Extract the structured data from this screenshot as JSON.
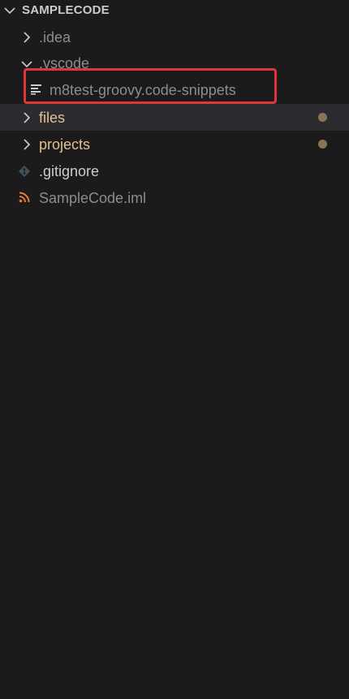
{
  "explorer": {
    "section_title": "SAMPLECODE",
    "items": [
      {
        "label": ".idea",
        "kind": "folder",
        "state": "collapsed",
        "icon": "chevron-right-icon"
      },
      {
        "label": ".vscode",
        "kind": "folder",
        "state": "expanded",
        "icon": "chevron-down-icon"
      },
      {
        "label": "m8test-groovy.code-snippets",
        "kind": "file",
        "icon": "snippets-file-icon"
      },
      {
        "label": "files",
        "kind": "folder",
        "state": "collapsed",
        "modified": true,
        "selected": true,
        "icon": "chevron-right-icon"
      },
      {
        "label": "projects",
        "kind": "folder",
        "state": "collapsed",
        "modified": true,
        "icon": "chevron-right-icon"
      },
      {
        "label": ".gitignore",
        "kind": "file",
        "icon": "git-file-icon"
      },
      {
        "label": "SampleCode.iml",
        "kind": "file",
        "icon": "rss-file-icon"
      }
    ]
  },
  "colors": {
    "background": "#1b1b1c",
    "selected_row": "#2b2b30",
    "modified_folder": "#e2c08d",
    "modified_dot": "#8a7456",
    "muted_text": "#8c8c8c",
    "highlight_border": "#e0353a",
    "gitignore_icon": "#41535b",
    "iml_icon": "#e37933"
  }
}
